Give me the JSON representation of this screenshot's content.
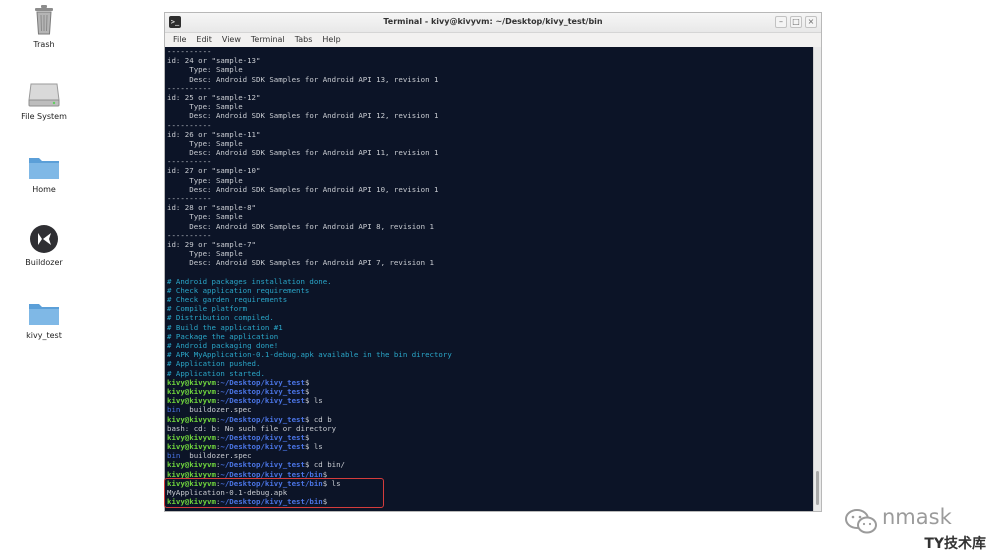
{
  "desktop": {
    "icons": [
      {
        "label": "Trash",
        "icon": "trash-icon"
      },
      {
        "label": "File System",
        "icon": "drive-icon"
      },
      {
        "label": "Home",
        "icon": "folder-icon"
      },
      {
        "label": "Buildozer",
        "icon": "kivy-logo-icon"
      },
      {
        "label": "kivy_test",
        "icon": "folder-icon"
      }
    ]
  },
  "window": {
    "title": "Terminal - kivy@kivyvm: ~/Desktop/kivy_test/bin",
    "buttons": [
      "minimize",
      "maximize",
      "close"
    ],
    "menu": [
      "File",
      "Edit",
      "View",
      "Terminal",
      "Tabs",
      "Help"
    ]
  },
  "terminal": {
    "lines": [
      [
        {
          "t": "----------",
          "c": "white"
        }
      ],
      [
        {
          "t": "id: 24 or \"sample-13\"",
          "c": "white"
        }
      ],
      [
        {
          "t": "     Type: Sample",
          "c": "white"
        }
      ],
      [
        {
          "t": "     Desc: Android SDK Samples for Android API 13, revision 1",
          "c": "white"
        }
      ],
      [
        {
          "t": "----------",
          "c": "white"
        }
      ],
      [
        {
          "t": "id: 25 or \"sample-12\"",
          "c": "white"
        }
      ],
      [
        {
          "t": "     Type: Sample",
          "c": "white"
        }
      ],
      [
        {
          "t": "     Desc: Android SDK Samples for Android API 12, revision 1",
          "c": "white"
        }
      ],
      [
        {
          "t": "----------",
          "c": "white"
        }
      ],
      [
        {
          "t": "id: 26 or \"sample-11\"",
          "c": "white"
        }
      ],
      [
        {
          "t": "     Type: Sample",
          "c": "white"
        }
      ],
      [
        {
          "t": "     Desc: Android SDK Samples for Android API 11, revision 1",
          "c": "white"
        }
      ],
      [
        {
          "t": "----------",
          "c": "white"
        }
      ],
      [
        {
          "t": "id: 27 or \"sample-10\"",
          "c": "white"
        }
      ],
      [
        {
          "t": "     Type: Sample",
          "c": "white"
        }
      ],
      [
        {
          "t": "     Desc: Android SDK Samples for Android API 10, revision 1",
          "c": "white"
        }
      ],
      [
        {
          "t": "----------",
          "c": "white"
        }
      ],
      [
        {
          "t": "id: 28 or \"sample-8\"",
          "c": "white"
        }
      ],
      [
        {
          "t": "     Type: Sample",
          "c": "white"
        }
      ],
      [
        {
          "t": "     Desc: Android SDK Samples for Android API 8, revision 1",
          "c": "white"
        }
      ],
      [
        {
          "t": "----------",
          "c": "white"
        }
      ],
      [
        {
          "t": "id: 29 or \"sample-7\"",
          "c": "white"
        }
      ],
      [
        {
          "t": "     Type: Sample",
          "c": "white"
        }
      ],
      [
        {
          "t": "     Desc: Android SDK Samples for Android API 7, revision 1",
          "c": "white"
        }
      ],
      [
        {
          "t": "",
          "c": "white"
        }
      ],
      [
        {
          "t": "# Android packages installation done.",
          "c": "cyan"
        }
      ],
      [
        {
          "t": "# Check application requirements",
          "c": "cyan"
        }
      ],
      [
        {
          "t": "# Check garden requirements",
          "c": "cyan"
        }
      ],
      [
        {
          "t": "# Compile platform",
          "c": "cyan"
        }
      ],
      [
        {
          "t": "# Distribution compiled.",
          "c": "cyan"
        }
      ],
      [
        {
          "t": "# Build the application #1",
          "c": "cyan"
        }
      ],
      [
        {
          "t": "# Package the application",
          "c": "cyan"
        }
      ],
      [
        {
          "t": "# Android packaging done!",
          "c": "cyan"
        }
      ],
      [
        {
          "t": "# APK MyApplication-0.1-debug.apk available in the bin directory",
          "c": "cyan"
        }
      ],
      [
        {
          "t": "# Application pushed.",
          "c": "cyan"
        }
      ],
      [
        {
          "t": "# Application started.",
          "c": "cyan"
        }
      ],
      [
        {
          "t": "kivy@kivyvm",
          "c": "green"
        },
        {
          "t": ":",
          "c": "white"
        },
        {
          "t": "~/Desktop/kivy_test",
          "c": "blue"
        },
        {
          "t": "$",
          "c": "white"
        }
      ],
      [
        {
          "t": "kivy@kivyvm",
          "c": "green"
        },
        {
          "t": ":",
          "c": "white"
        },
        {
          "t": "~/Desktop/kivy_test",
          "c": "blue"
        },
        {
          "t": "$",
          "c": "white"
        }
      ],
      [
        {
          "t": "kivy@kivyvm",
          "c": "green"
        },
        {
          "t": ":",
          "c": "white"
        },
        {
          "t": "~/Desktop/kivy_test",
          "c": "blue"
        },
        {
          "t": "$ ls",
          "c": "white"
        }
      ],
      [
        {
          "t": "bin",
          "c": "dir"
        },
        {
          "t": "  buildozer.spec",
          "c": "white"
        }
      ],
      [
        {
          "t": "kivy@kivyvm",
          "c": "green"
        },
        {
          "t": ":",
          "c": "white"
        },
        {
          "t": "~/Desktop/kivy_test",
          "c": "blue"
        },
        {
          "t": "$ cd b",
          "c": "white"
        }
      ],
      [
        {
          "t": "bash: cd: b: No such file or directory",
          "c": "white"
        }
      ],
      [
        {
          "t": "kivy@kivyvm",
          "c": "green"
        },
        {
          "t": ":",
          "c": "white"
        },
        {
          "t": "~/Desktop/kivy_test",
          "c": "blue"
        },
        {
          "t": "$",
          "c": "white"
        }
      ],
      [
        {
          "t": "kivy@kivyvm",
          "c": "green"
        },
        {
          "t": ":",
          "c": "white"
        },
        {
          "t": "~/Desktop/kivy_test",
          "c": "blue"
        },
        {
          "t": "$ ls",
          "c": "white"
        }
      ],
      [
        {
          "t": "bin",
          "c": "dir"
        },
        {
          "t": "  buildozer.spec",
          "c": "white"
        }
      ],
      [
        {
          "t": "kivy@kivyvm",
          "c": "green"
        },
        {
          "t": ":",
          "c": "white"
        },
        {
          "t": "~/Desktop/kivy_test",
          "c": "blue"
        },
        {
          "t": "$ cd bin/",
          "c": "white"
        }
      ],
      [
        {
          "t": "kivy@kivyvm",
          "c": "green"
        },
        {
          "t": ":",
          "c": "white"
        },
        {
          "t": "~/Desktop/kivy_test/bin",
          "c": "blue"
        },
        {
          "t": "$",
          "c": "white"
        }
      ],
      [
        {
          "t": "kivy@kivyvm",
          "c": "green"
        },
        {
          "t": ":",
          "c": "white"
        },
        {
          "t": "~/Desktop/kivy_test/bin",
          "c": "blue"
        },
        {
          "t": "$ ls",
          "c": "white"
        }
      ],
      [
        {
          "t": "MyApplication-0.1-debug.apk",
          "c": "white"
        }
      ],
      [
        {
          "t": "kivy@kivyvm",
          "c": "green"
        },
        {
          "t": ":",
          "c": "white"
        },
        {
          "t": "~/Desktop/kivy_test/bin",
          "c": "blue"
        },
        {
          "t": "$ ",
          "c": "white"
        }
      ]
    ]
  },
  "watermark": {
    "brand": "nmask",
    "site": "TY技术库"
  },
  "colors": {
    "terminal_bg": "#0c1427",
    "prompt_user": "#6fd43d",
    "prompt_path": "#4a74e4",
    "comment": "#2aa6c8",
    "highlight_box": "#d43c3c"
  }
}
